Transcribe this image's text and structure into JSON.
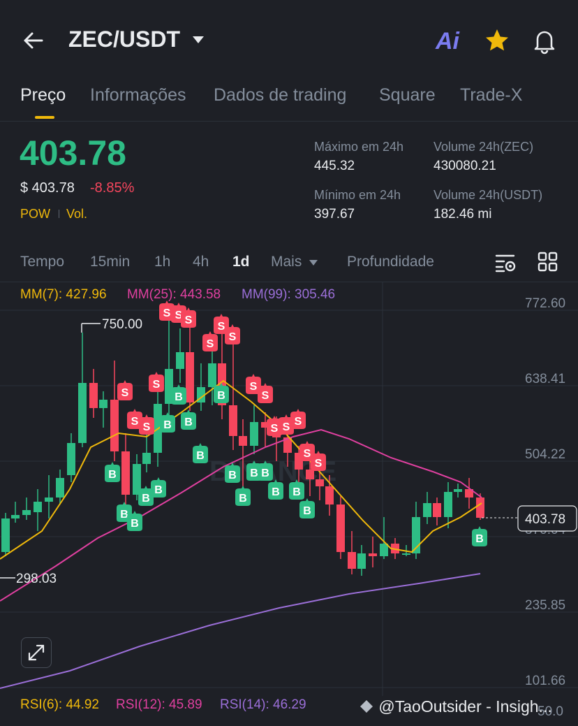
{
  "header": {
    "pair": "ZEC/USDT",
    "ai_label": "Ai"
  },
  "tabs": [
    {
      "label": "Preço",
      "active": true
    },
    {
      "label": "Informações"
    },
    {
      "label": "Dados de trading"
    },
    {
      "label": "Square"
    },
    {
      "label": "Trade-X"
    }
  ],
  "price": {
    "last": "403.78",
    "usd": "$ 403.78",
    "change": "-8.85%",
    "tag_pow": "POW",
    "tag_vol": "Vol."
  },
  "stats": {
    "high_label": "Máximo em 24h",
    "high_value": "445.32",
    "low_label": "Mínimo em 24h",
    "low_value": "397.67",
    "vol_base_label": "Volume 24h(ZEC)",
    "vol_base_value": "430080.21",
    "vol_quote_label": "Volume 24h(USDT)",
    "vol_quote_value": "182.46 mi"
  },
  "intervals": {
    "items": [
      "Tempo",
      "15min",
      "1h",
      "4h",
      "1d",
      "Mais"
    ],
    "active": "1d",
    "depth": "Profundidade"
  },
  "ma_legend": {
    "ma7": "MM(7): 427.96",
    "ma25": "MM(25): 443.58",
    "ma99": "MM(99): 305.46"
  },
  "chart": {
    "y_ticks": [
      "772.60",
      "638.41",
      "504.22",
      "370.04",
      "235.85",
      "101.66"
    ],
    "high_marker": "750.00",
    "low_marker": "298.03",
    "last_price_tag": "403.78",
    "ylim": [
      101.66,
      772.6
    ],
    "watermark": "BINANCE"
  },
  "rsi": {
    "rsi6": "RSI(6): 44.92",
    "rsi12": "RSI(12): 45.89",
    "rsi14": "RSI(14): 46.29",
    "axis_cut": "50.0"
  },
  "watermark": "@TaoOutsider - Insigh...",
  "colors": {
    "up": "#2ebd85",
    "down": "#f6465d",
    "ma7": "#f0b90b",
    "ma25": "#e040a0",
    "ma99": "#9b6fd8",
    "accent": "#f0b90b"
  }
}
